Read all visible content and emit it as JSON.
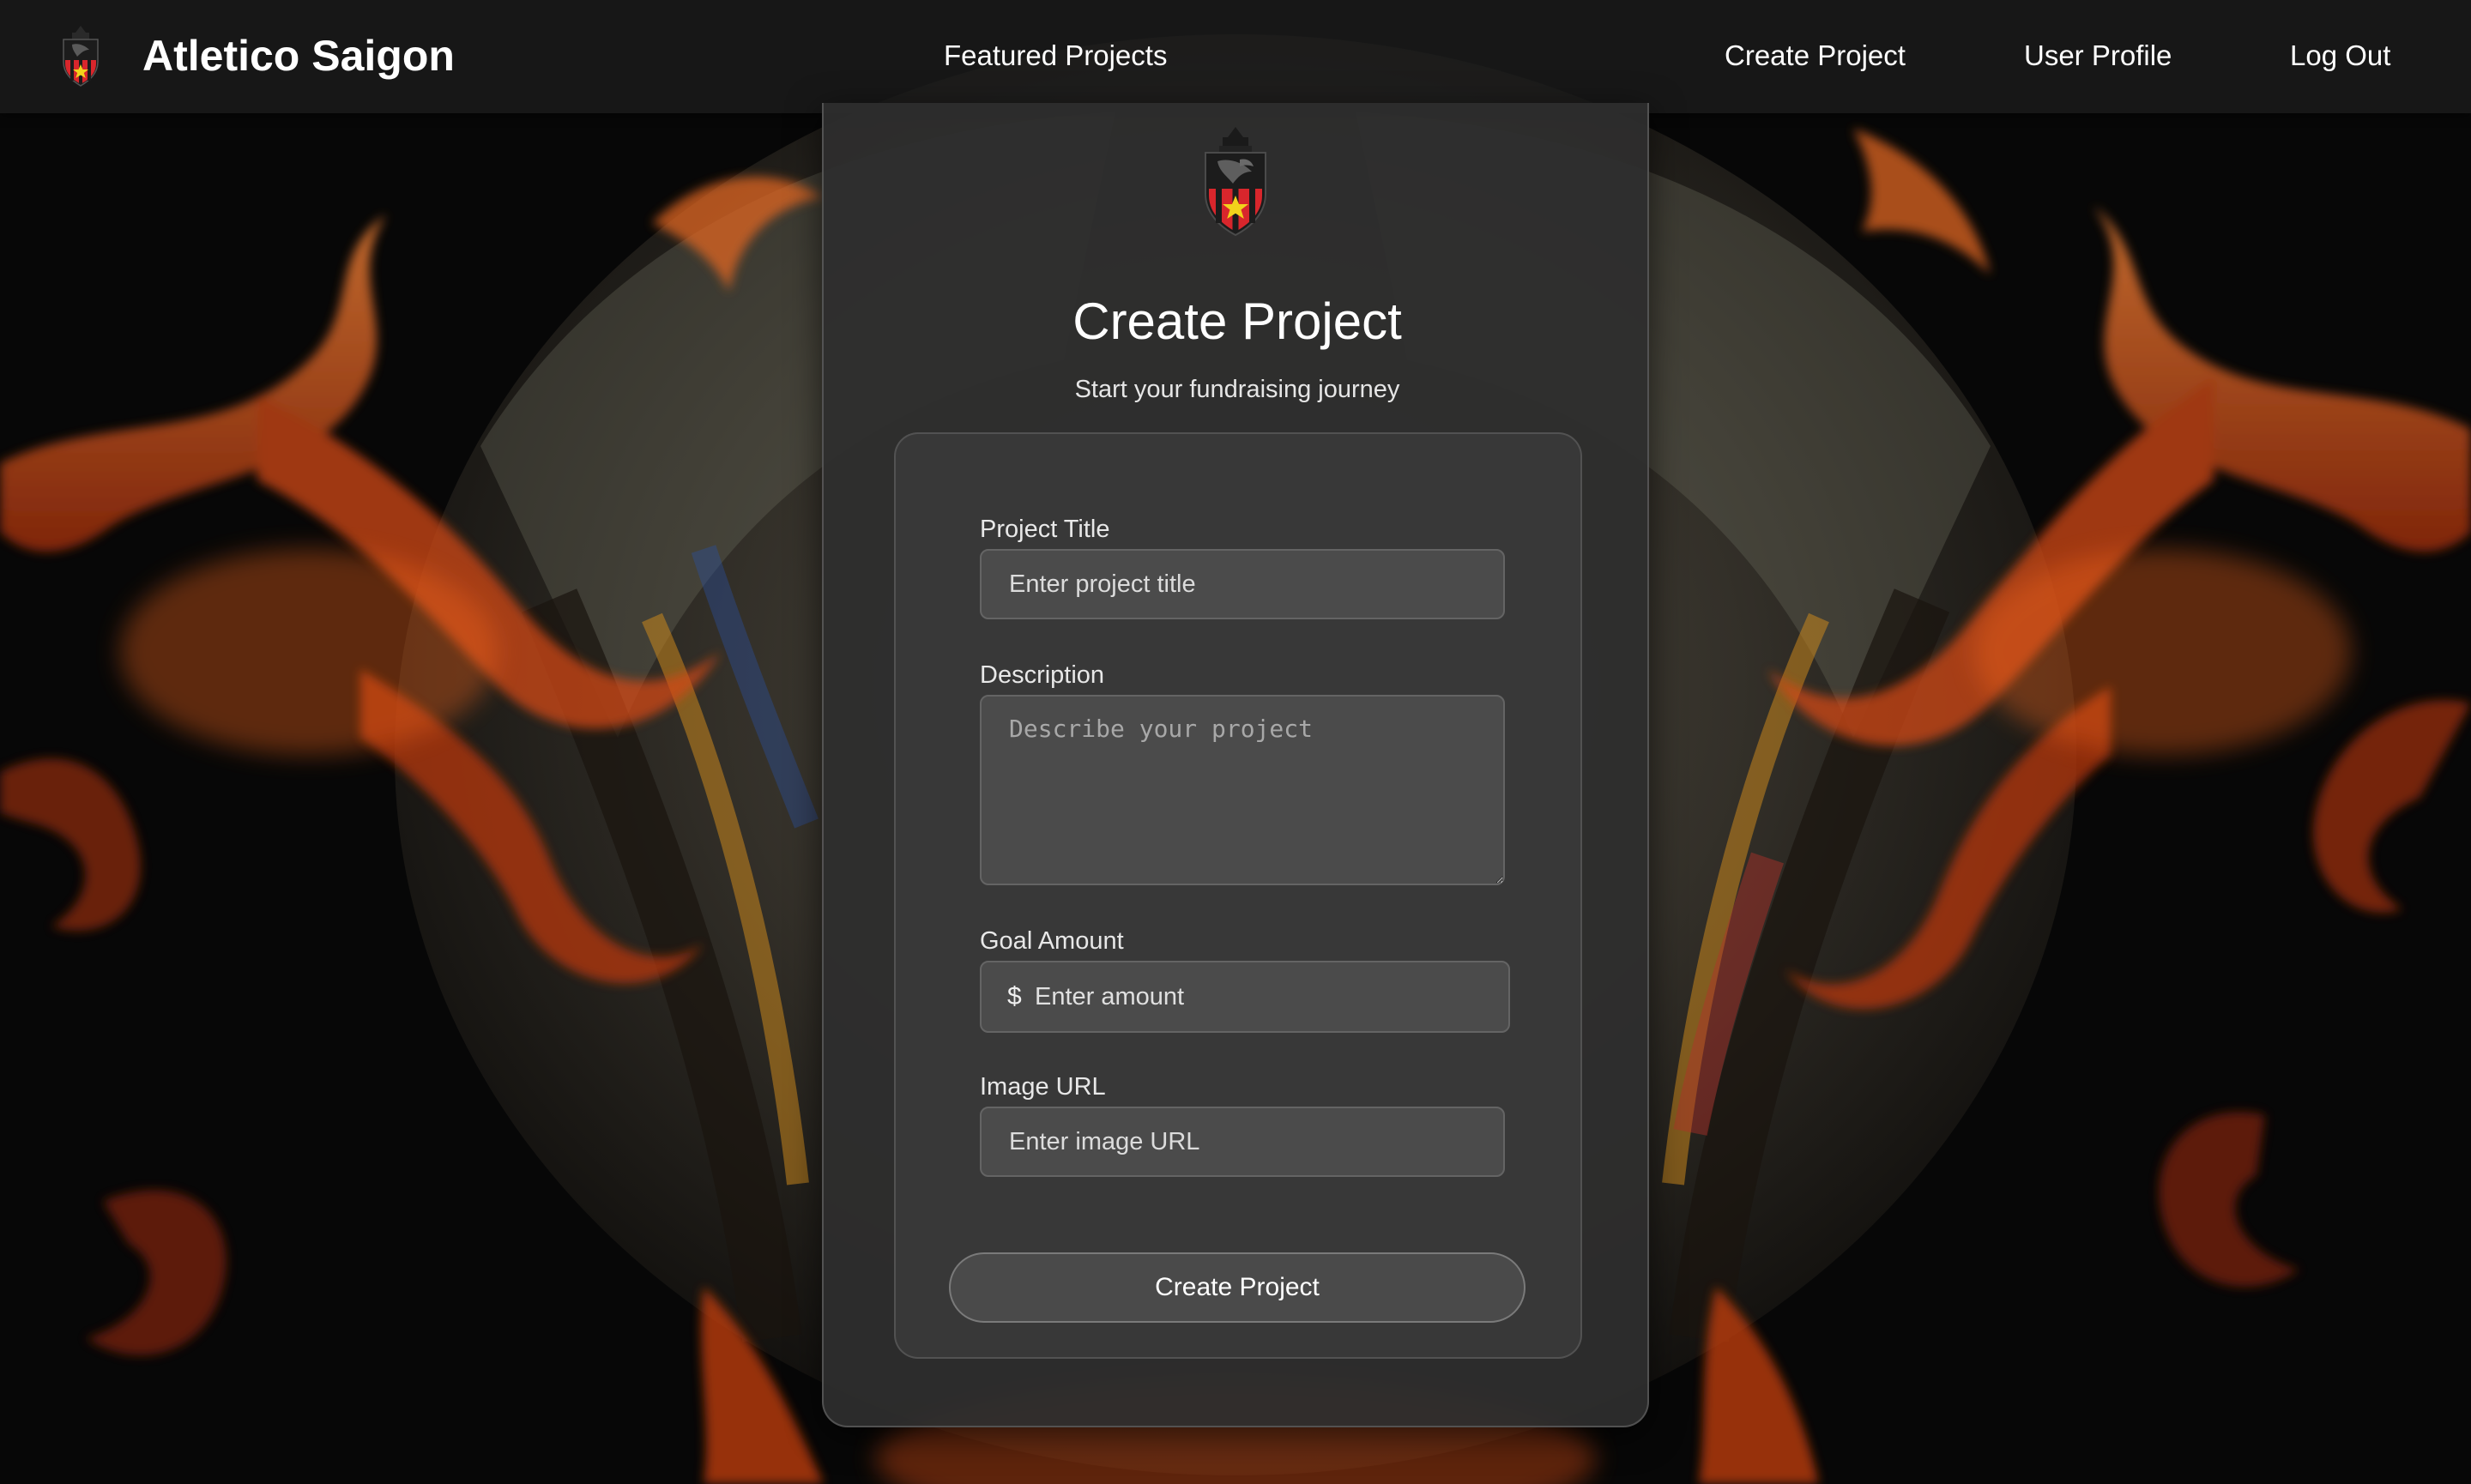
{
  "navbar": {
    "brand": "Atletico Saigon",
    "links": {
      "featured": "Featured Projects",
      "create": "Create Project",
      "profile": "User Profile",
      "logout": "Log Out"
    }
  },
  "card": {
    "title": "Create Project",
    "subtitle": "Start your fundraising journey"
  },
  "form": {
    "title_label": "Project Title",
    "title_placeholder": "Enter project title",
    "description_label": "Description",
    "description_placeholder": "Describe your project",
    "goal_label": "Goal Amount",
    "goal_prefix": "$",
    "goal_placeholder": "Enter amount",
    "image_label": "Image URL",
    "image_placeholder": "Enter image URL",
    "submit_label": "Create Project"
  },
  "icons": {
    "brand_logo": "club-crest-icon",
    "card_logo": "club-crest-icon"
  },
  "colors": {
    "crest_red": "#d8262c",
    "crest_star": "#f2d21b",
    "flame": "#e05a1c"
  }
}
